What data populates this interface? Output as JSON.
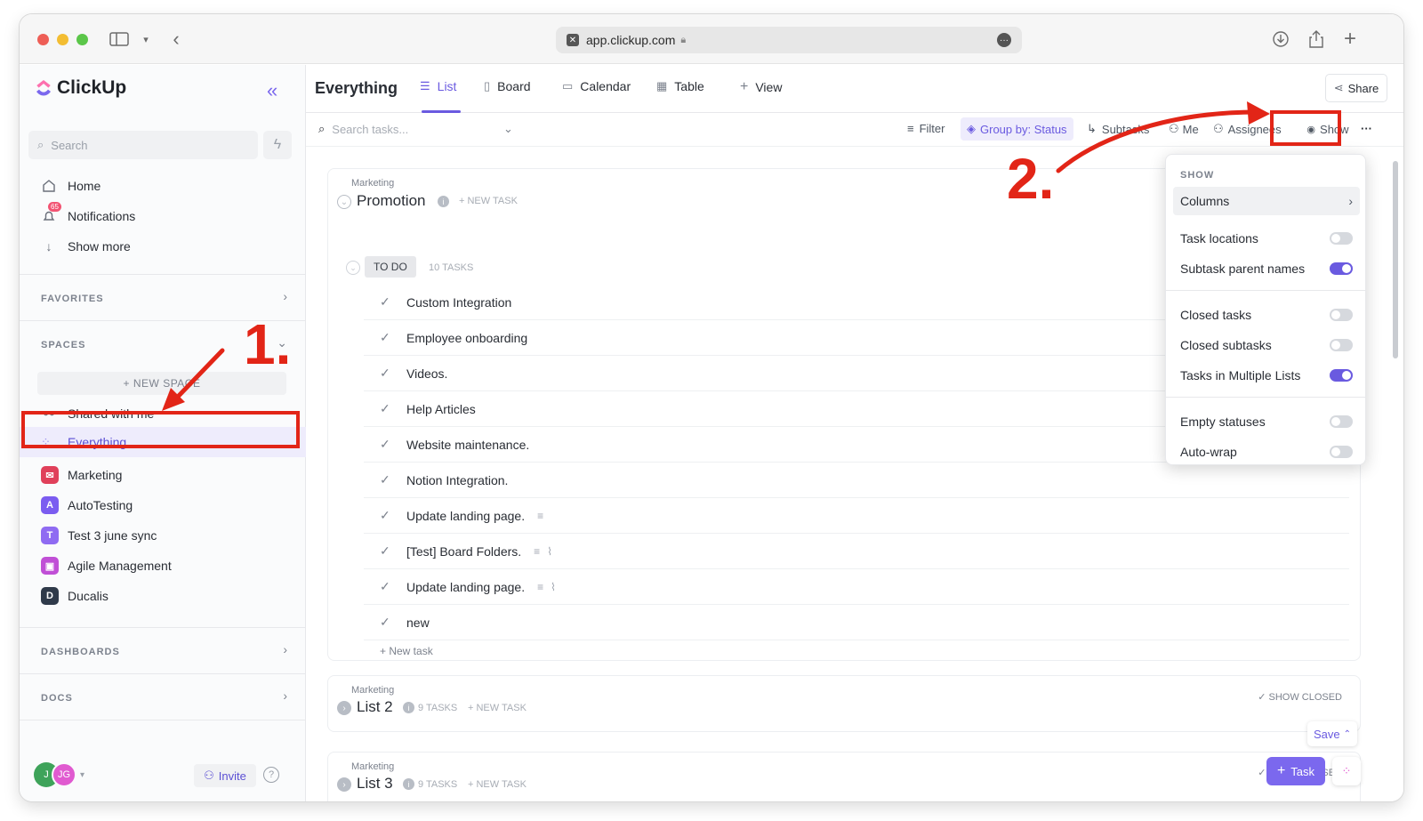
{
  "browser": {
    "url": "app.clickup.com"
  },
  "sidebar": {
    "brand": "ClickUp",
    "search_placeholder": "Search",
    "nav": [
      {
        "label": "Home",
        "icon": "home-icon"
      },
      {
        "label": "Notifications",
        "icon": "bell-icon",
        "badge": "65"
      },
      {
        "label": "Show more",
        "icon": "arrow-down-icon"
      }
    ],
    "favorites_label": "FAVORITES",
    "spaces_label": "SPACES",
    "new_space_label": "+ NEW SPACE",
    "shared_label": "Shared with me",
    "everything_label": "Everything",
    "spaces": [
      {
        "label": "Marketing",
        "badge": "✉",
        "color": "#e0405a"
      },
      {
        "label": "AutoTesting",
        "badge": "A",
        "color": "#7b5cf0"
      },
      {
        "label": "Test 3 june sync",
        "badge": "T",
        "color": "#8f6bf2"
      },
      {
        "label": "Agile Management",
        "badge": "▣",
        "color": "#c04fd6"
      },
      {
        "label": "Ducalis",
        "badge": "D",
        "color": "#2f3a4a"
      }
    ],
    "dashboards_label": "DASHBOARDS",
    "docs_label": "DOCS",
    "invite_label": "Invite",
    "avatar_j": "J",
    "avatar_jg": "JG"
  },
  "header": {
    "title": "Everything",
    "tabs": [
      {
        "label": "List",
        "icon": "list-icon"
      },
      {
        "label": "Board",
        "icon": "board-icon"
      },
      {
        "label": "Calendar",
        "icon": "calendar-icon"
      },
      {
        "label": "Table",
        "icon": "table-icon"
      },
      {
        "label": "View",
        "icon": "plus-icon"
      }
    ],
    "share_label": "Share"
  },
  "toolbar": {
    "search_placeholder": "Search tasks...",
    "filter_label": "Filter",
    "group_label": "Group by: Status",
    "subtasks_label": "Subtasks",
    "me_label": "Me",
    "assignees_label": "Assignees",
    "show_label": "Show"
  },
  "promotion": {
    "space": "Marketing",
    "name": "Promotion",
    "new_task": "+ NEW TASK",
    "status": "TO DO",
    "count": "10 TASKS",
    "tasks": [
      {
        "name": "Custom Integration",
        "desc": false,
        "attach": false
      },
      {
        "name": "Employee onboarding",
        "desc": false,
        "attach": false
      },
      {
        "name": "Videos.",
        "desc": false,
        "attach": false
      },
      {
        "name": "Help Articles",
        "desc": false,
        "attach": false
      },
      {
        "name": "Website maintenance.",
        "desc": false,
        "attach": false
      },
      {
        "name": "Notion Integration.",
        "desc": false,
        "attach": false
      },
      {
        "name": "Update landing page.",
        "desc": true,
        "attach": false
      },
      {
        "name": "[Test] Board Folders.",
        "desc": true,
        "attach": true
      },
      {
        "name": "Update landing page.",
        "desc": true,
        "attach": true
      },
      {
        "name": "new",
        "desc": false,
        "attach": false
      }
    ],
    "add_task": "+ New task"
  },
  "list2": {
    "space": "Marketing",
    "name": "List 2",
    "count": "9 TASKS",
    "new_task": "+ NEW TASK",
    "show_closed": "SHOW CLOSED"
  },
  "list3": {
    "space": "Marketing",
    "name": "List 3",
    "count": "9 TASKS",
    "new_task": "+ NEW TASK",
    "show_closed": "SHOW CLOSED"
  },
  "show_panel": {
    "heading": "SHOW",
    "columns_label": "Columns",
    "items": [
      {
        "label": "Task locations",
        "on": false
      },
      {
        "label": "Subtask parent names",
        "on": true
      },
      {
        "label": "Closed tasks",
        "on": false
      },
      {
        "label": "Closed subtasks",
        "on": false
      },
      {
        "label": "Tasks in Multiple Lists",
        "on": true
      },
      {
        "label": "Empty statuses",
        "on": false
      },
      {
        "label": "Auto-wrap",
        "on": false
      }
    ]
  },
  "floating": {
    "save_label": "Save",
    "task_label": "Task"
  },
  "annotations": {
    "step1": "1.",
    "step2": "2."
  }
}
